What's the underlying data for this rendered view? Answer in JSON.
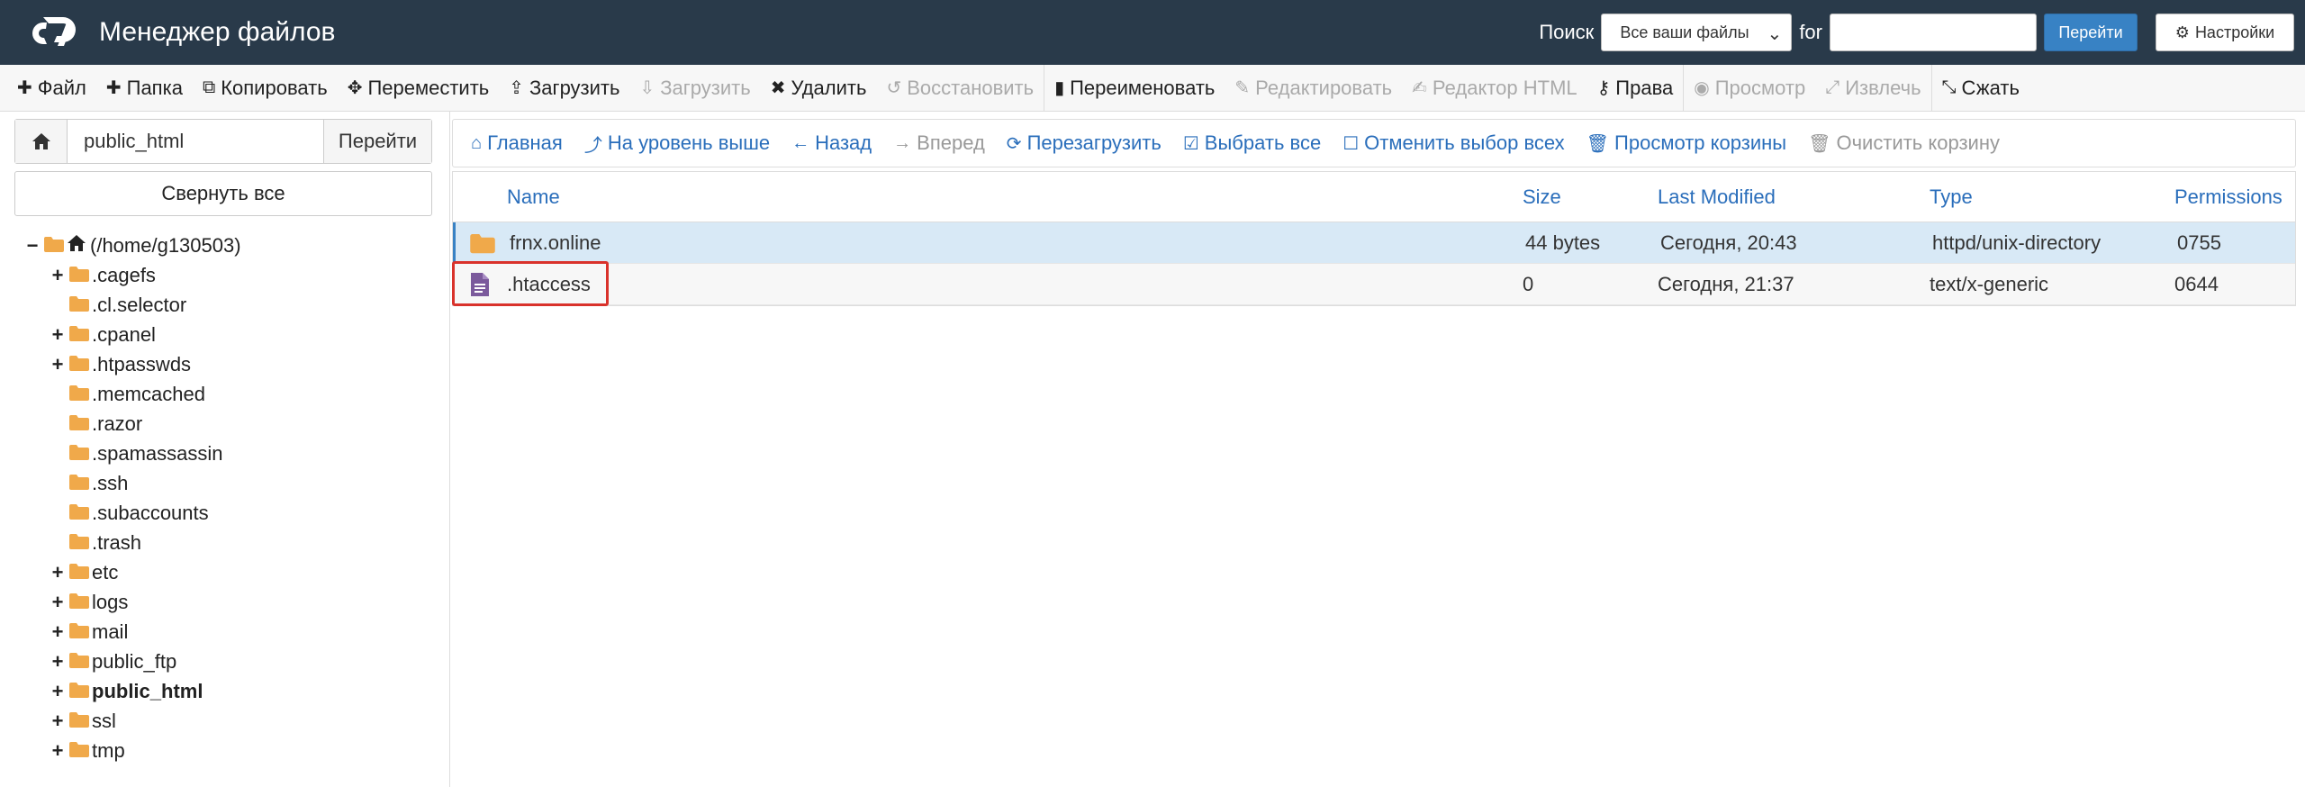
{
  "header": {
    "title": "Менеджер файлов",
    "search_label": "Поиск",
    "scope_value": "Все ваши файлы",
    "for_label": "for",
    "search_value": "",
    "go_label": "Перейти",
    "settings_label": "Настройки"
  },
  "toolbar": {
    "items": [
      {
        "label": "Файл",
        "icon": "plus-icon"
      },
      {
        "label": "Папка",
        "icon": "plus-icon"
      },
      {
        "label": "Копировать",
        "icon": "copy-icon"
      },
      {
        "label": "Переместить",
        "icon": "move-icon"
      },
      {
        "label": "Загрузить",
        "icon": "upload-icon"
      },
      {
        "label": "Загрузить",
        "icon": "download-icon",
        "disabled": true
      },
      {
        "label": "Удалить",
        "icon": "close-icon"
      },
      {
        "label": "Восстановить",
        "icon": "undo-icon",
        "disabled": true
      },
      {
        "label": "Переименовать",
        "icon": "file-icon"
      },
      {
        "label": "Редактировать",
        "icon": "pencil-icon",
        "disabled": true
      },
      {
        "label": "Редактор HTML",
        "icon": "edit-icon",
        "disabled": true
      },
      {
        "label": "Права",
        "icon": "key-icon"
      },
      {
        "label": "Просмотр",
        "icon": "eye-icon",
        "disabled": true
      },
      {
        "label": "Извлечь",
        "icon": "expand-icon",
        "disabled": true
      },
      {
        "label": "Сжать",
        "icon": "compress-icon"
      }
    ]
  },
  "sidebar": {
    "path_value": "public_html",
    "go_label": "Перейти",
    "collapse_label": "Свернуть все",
    "tree": [
      {
        "label": "(/home/g130503)",
        "level": 0,
        "toggle": "−",
        "icon": "home"
      },
      {
        "label": ".cagefs",
        "level": 1,
        "toggle": "+"
      },
      {
        "label": ".cl.selector",
        "level": 1,
        "toggle": ""
      },
      {
        "label": ".cpanel",
        "level": 1,
        "toggle": "+"
      },
      {
        "label": ".htpasswds",
        "level": 1,
        "toggle": "+"
      },
      {
        "label": ".memcached",
        "level": 1,
        "toggle": ""
      },
      {
        "label": ".razor",
        "level": 1,
        "toggle": ""
      },
      {
        "label": ".spamassassin",
        "level": 1,
        "toggle": ""
      },
      {
        "label": ".ssh",
        "level": 1,
        "toggle": ""
      },
      {
        "label": ".subaccounts",
        "level": 1,
        "toggle": ""
      },
      {
        "label": ".trash",
        "level": 1,
        "toggle": ""
      },
      {
        "label": "etc",
        "level": 1,
        "toggle": "+"
      },
      {
        "label": "logs",
        "level": 1,
        "toggle": "+"
      },
      {
        "label": "mail",
        "level": 1,
        "toggle": "+"
      },
      {
        "label": "public_ftp",
        "level": 1,
        "toggle": "+"
      },
      {
        "label": "public_html",
        "level": 1,
        "toggle": "+",
        "bold": true
      },
      {
        "label": "ssl",
        "level": 1,
        "toggle": "+"
      },
      {
        "label": "tmp",
        "level": 1,
        "toggle": "+"
      }
    ]
  },
  "nav": {
    "items": [
      {
        "label": "Главная",
        "icon": "home-icon"
      },
      {
        "label": "На уровень выше",
        "icon": "level-up-icon"
      },
      {
        "label": "Назад",
        "icon": "arrow-left-icon"
      },
      {
        "label": "Вперед",
        "icon": "arrow-right-icon",
        "disabled": true
      },
      {
        "label": "Перезагрузить",
        "icon": "refresh-icon"
      },
      {
        "label": "Выбрать все",
        "icon": "check-square-icon"
      },
      {
        "label": "Отменить выбор всех",
        "icon": "square-icon"
      },
      {
        "label": "Просмотр корзины",
        "icon": "trash-icon"
      },
      {
        "label": "Очистить корзину",
        "icon": "trash-icon",
        "disabled": true
      }
    ]
  },
  "table": {
    "headers": {
      "name": "Name",
      "size": "Size",
      "modified": "Last Modified",
      "type": "Type",
      "perms": "Permissions"
    },
    "rows": [
      {
        "icon": "folder",
        "name": "frnx.online",
        "size": "44 bytes",
        "modified": "Сегодня, 20:43",
        "type": "httpd/unix-directory",
        "perms": "0755"
      },
      {
        "icon": "file",
        "name": ".htaccess",
        "size": "0",
        "modified": "Сегодня, 21:37",
        "type": "text/x-generic",
        "perms": "0644"
      }
    ]
  },
  "colors": {
    "header_bg": "#293a4a",
    "accent": "#3882c4",
    "link": "#2a6ebb",
    "folder": "#f0a94a",
    "highlight": "#d9322b"
  }
}
